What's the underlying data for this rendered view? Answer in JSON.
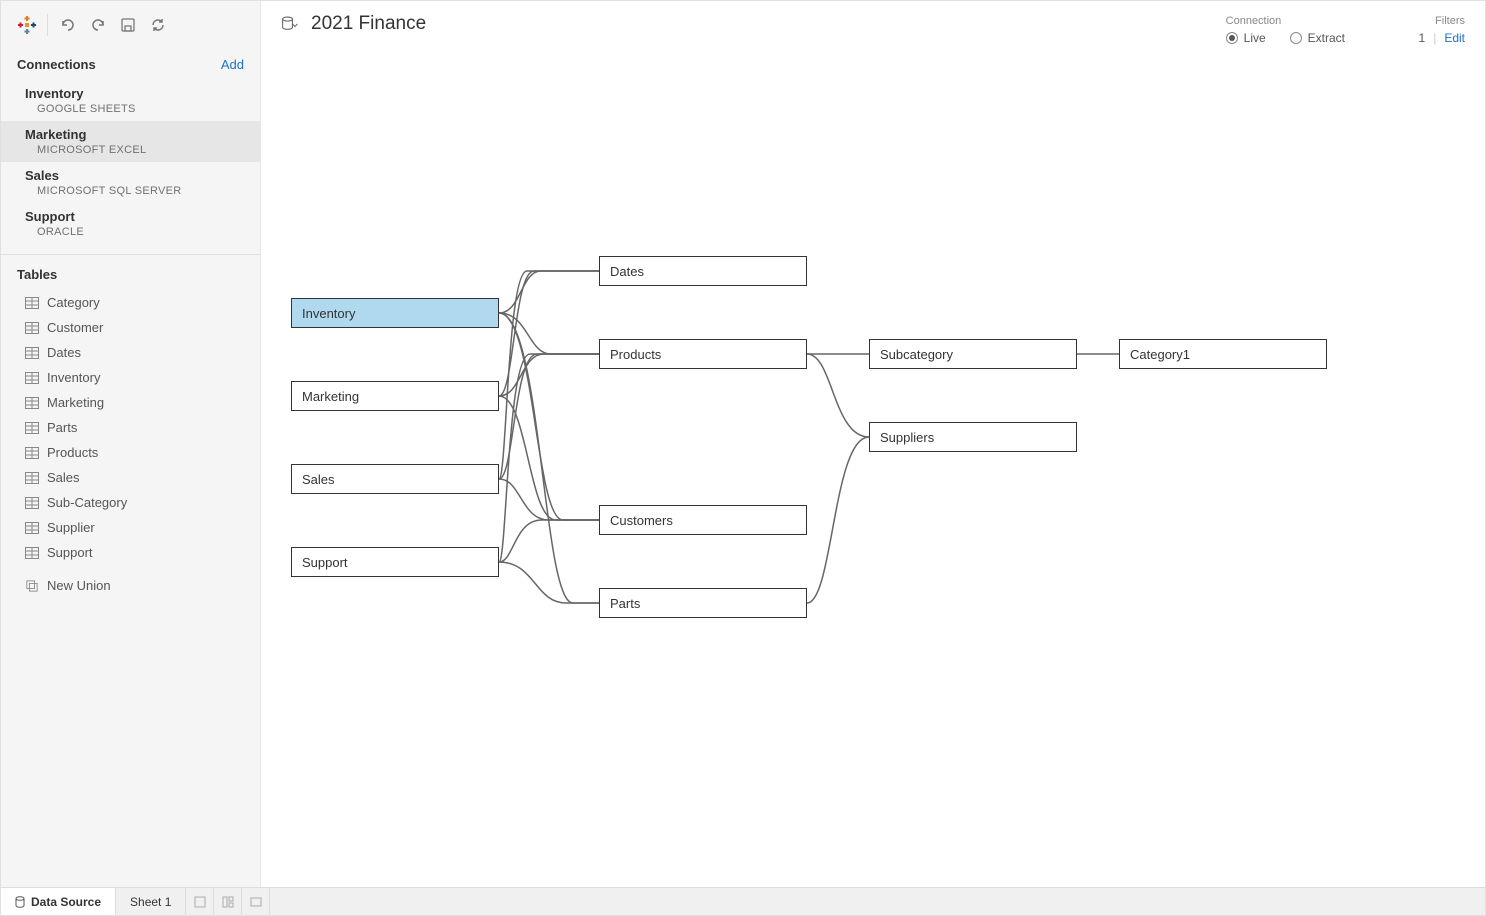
{
  "toolbar": {
    "title": "2021 Finance"
  },
  "sidebar": {
    "connections_label": "Connections",
    "add_label": "Add",
    "connections": [
      {
        "name": "Inventory",
        "type": "GOOGLE SHEETS",
        "selected": false
      },
      {
        "name": "Marketing",
        "type": "MICROSOFT EXCEL",
        "selected": true
      },
      {
        "name": "Sales",
        "type": "MICROSOFT SQL SERVER",
        "selected": false
      },
      {
        "name": "Support",
        "type": "ORACLE",
        "selected": false
      }
    ],
    "tables_label": "Tables",
    "tables": [
      "Category",
      "Customer",
      "Dates",
      "Inventory",
      "Marketing",
      "Parts",
      "Products",
      "Sales",
      "Sub-Category",
      "Supplier",
      "Support"
    ],
    "new_union_label": "New Union"
  },
  "connection_panel": {
    "label": "Connection",
    "live": "Live",
    "extract": "Extract"
  },
  "filters_panel": {
    "label": "Filters",
    "count": "1",
    "edit": "Edit"
  },
  "diagram": {
    "nodes": {
      "inventory": "Inventory",
      "marketing": "Marketing",
      "sales": "Sales",
      "support": "Support",
      "dates": "Dates",
      "products": "Products",
      "customers": "Customers",
      "parts": "Parts",
      "subcategory": "Subcategory",
      "category1": "Category1",
      "suppliers": "Suppliers"
    }
  },
  "tabs": {
    "data_source": "Data Source",
    "sheet1": "Sheet 1"
  }
}
